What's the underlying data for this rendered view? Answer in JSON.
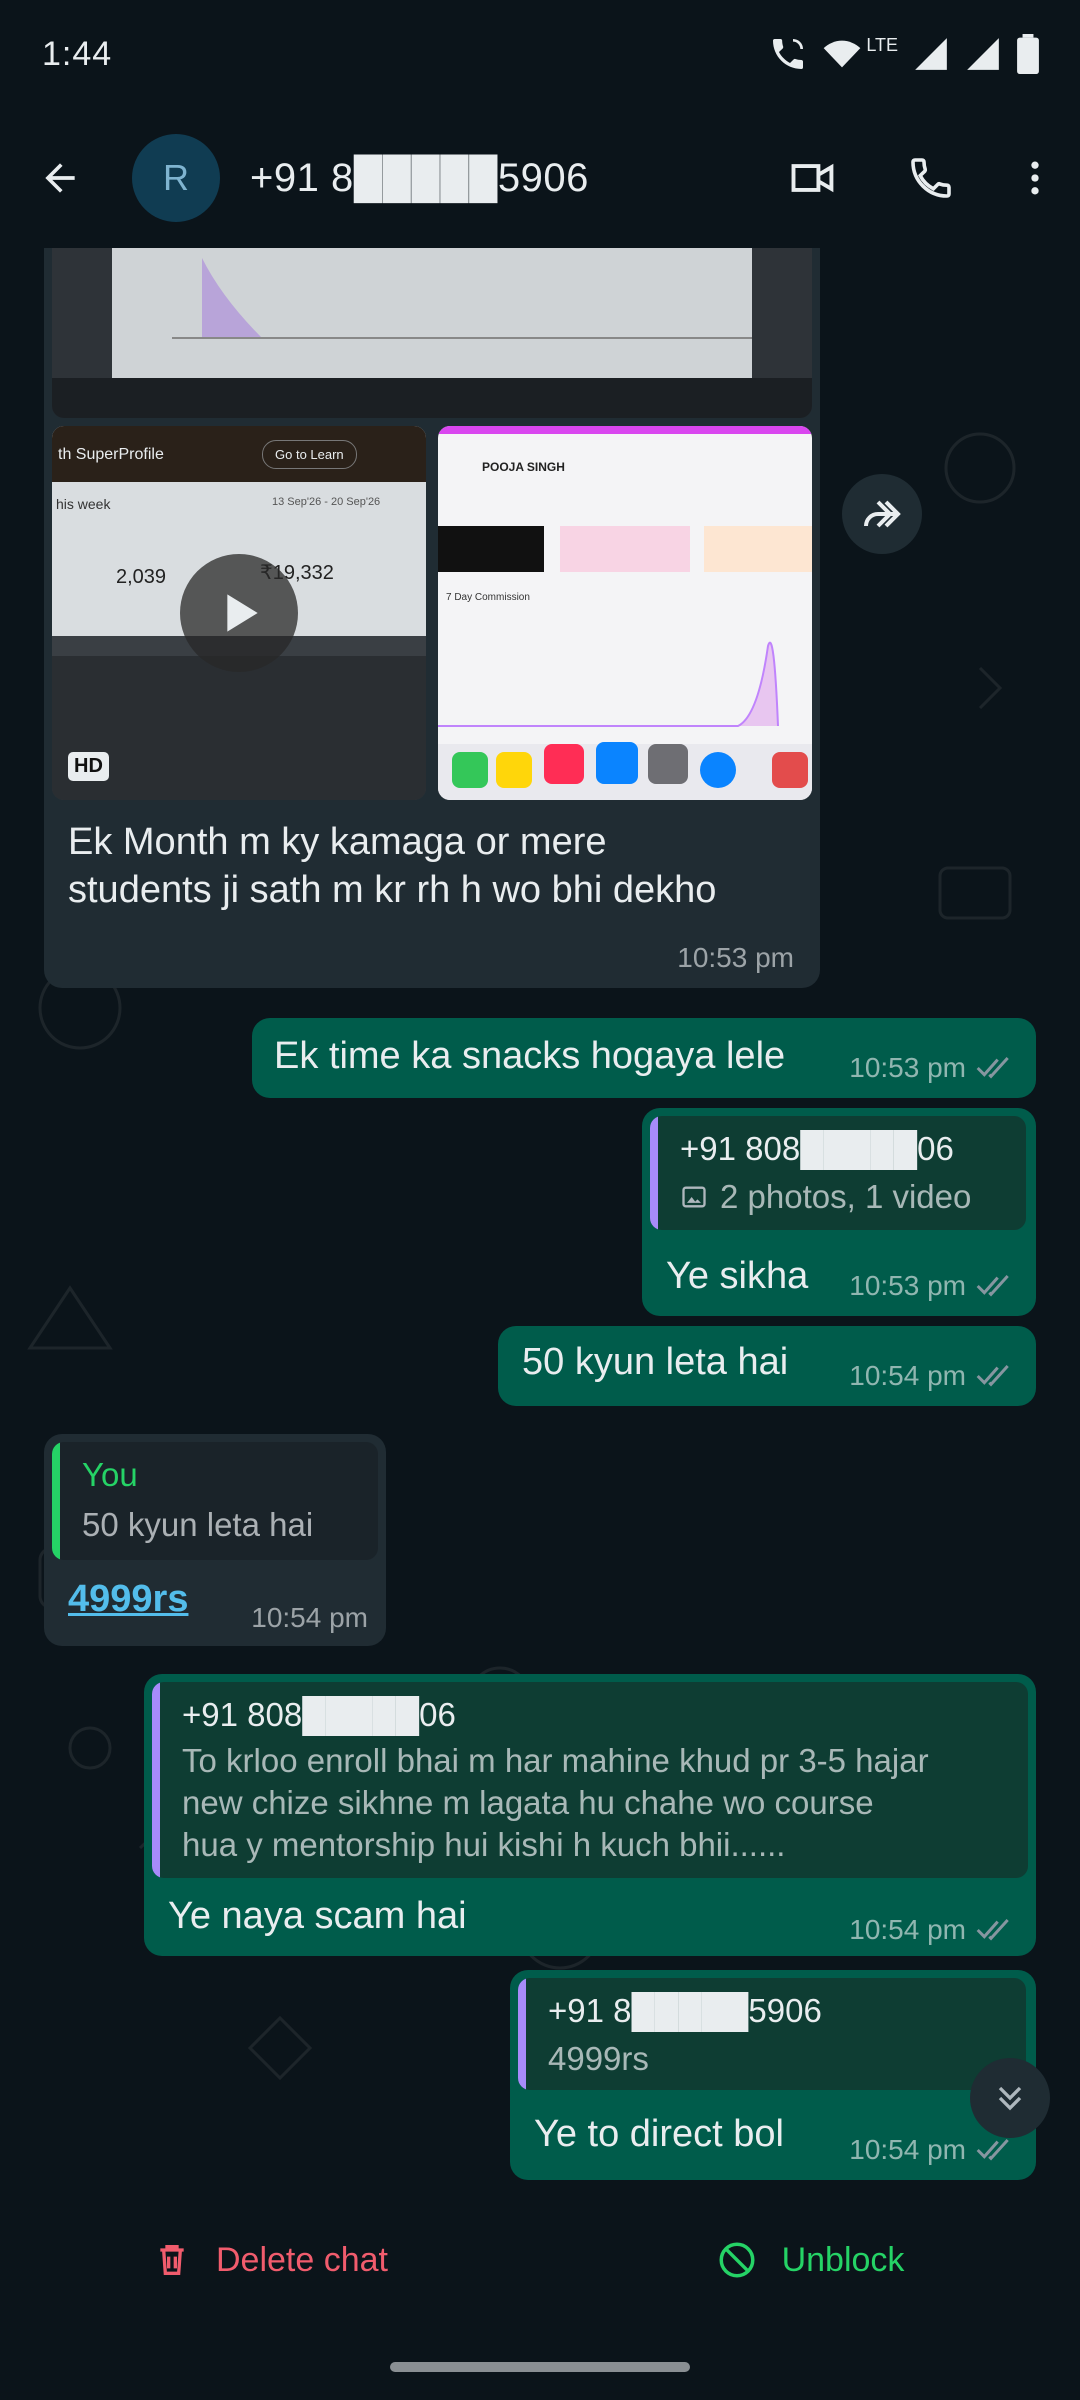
{
  "status_bar": {
    "time": "1:44",
    "network": "LTE"
  },
  "header": {
    "avatar_letter": "R",
    "contact": "+91 8█████5906"
  },
  "messages": {
    "media_caption_line1": "Ek Month m ky kamaga or mere",
    "media_caption_line2": "students ji sath m kr rh h wo bhi dekho",
    "media_time": "10:53 pm",
    "hd_badge": "HD",
    "thumb1_title": "th SuperProfile",
    "thumb1_button": "Go to Learn",
    "thumb1_week": "his week",
    "thumb1_range": "13 Sep'26 - 20 Sep'26",
    "thumb1_leads": "2,039",
    "thumb1_revenue": "₹19,332",
    "thumb2_name": "POOJA SINGH",
    "thumb2_sub": "7 Day Commission",
    "m1_text": "Ek time ka snacks hogaya lele",
    "m1_time": "10:53 pm",
    "m2_quote_name": "+91 808█████06",
    "m2_quote_text": "2 photos, 1 video",
    "m2_text": "Ye sikha",
    "m2_time": "10:53 pm",
    "m3_text": "50 kyun leta hai",
    "m3_time": "10:54 pm",
    "m4_quote_name": "You",
    "m4_quote_text": "50 kyun leta hai",
    "m4_text": "4999rs",
    "m4_time": "10:54 pm",
    "m5_quote_name": "+91 808█████06",
    "m5_quote_line1": "To krloo enroll bhai m har mahine khud pr 3-5 hajar",
    "m5_quote_line2": "new chize sikhne m lagata hu chahe wo course",
    "m5_quote_line3": "hua y mentorship hui kishi h kuch bhii......",
    "m5_text": "Ye naya scam hai",
    "m5_time": "10:54 pm",
    "m6_quote_name": "+91 8█████5906",
    "m6_quote_text": "4999rs",
    "m6_text": "Ye to direct bol",
    "m6_time": "10:54 pm"
  },
  "actions": {
    "delete": "Delete chat",
    "unblock": "Unblock"
  },
  "colors": {
    "incoming": "#202c33",
    "outgoing": "#005c4b",
    "delete": "#f15c6d",
    "unblock": "#25d366",
    "link": "#53bdeb"
  }
}
